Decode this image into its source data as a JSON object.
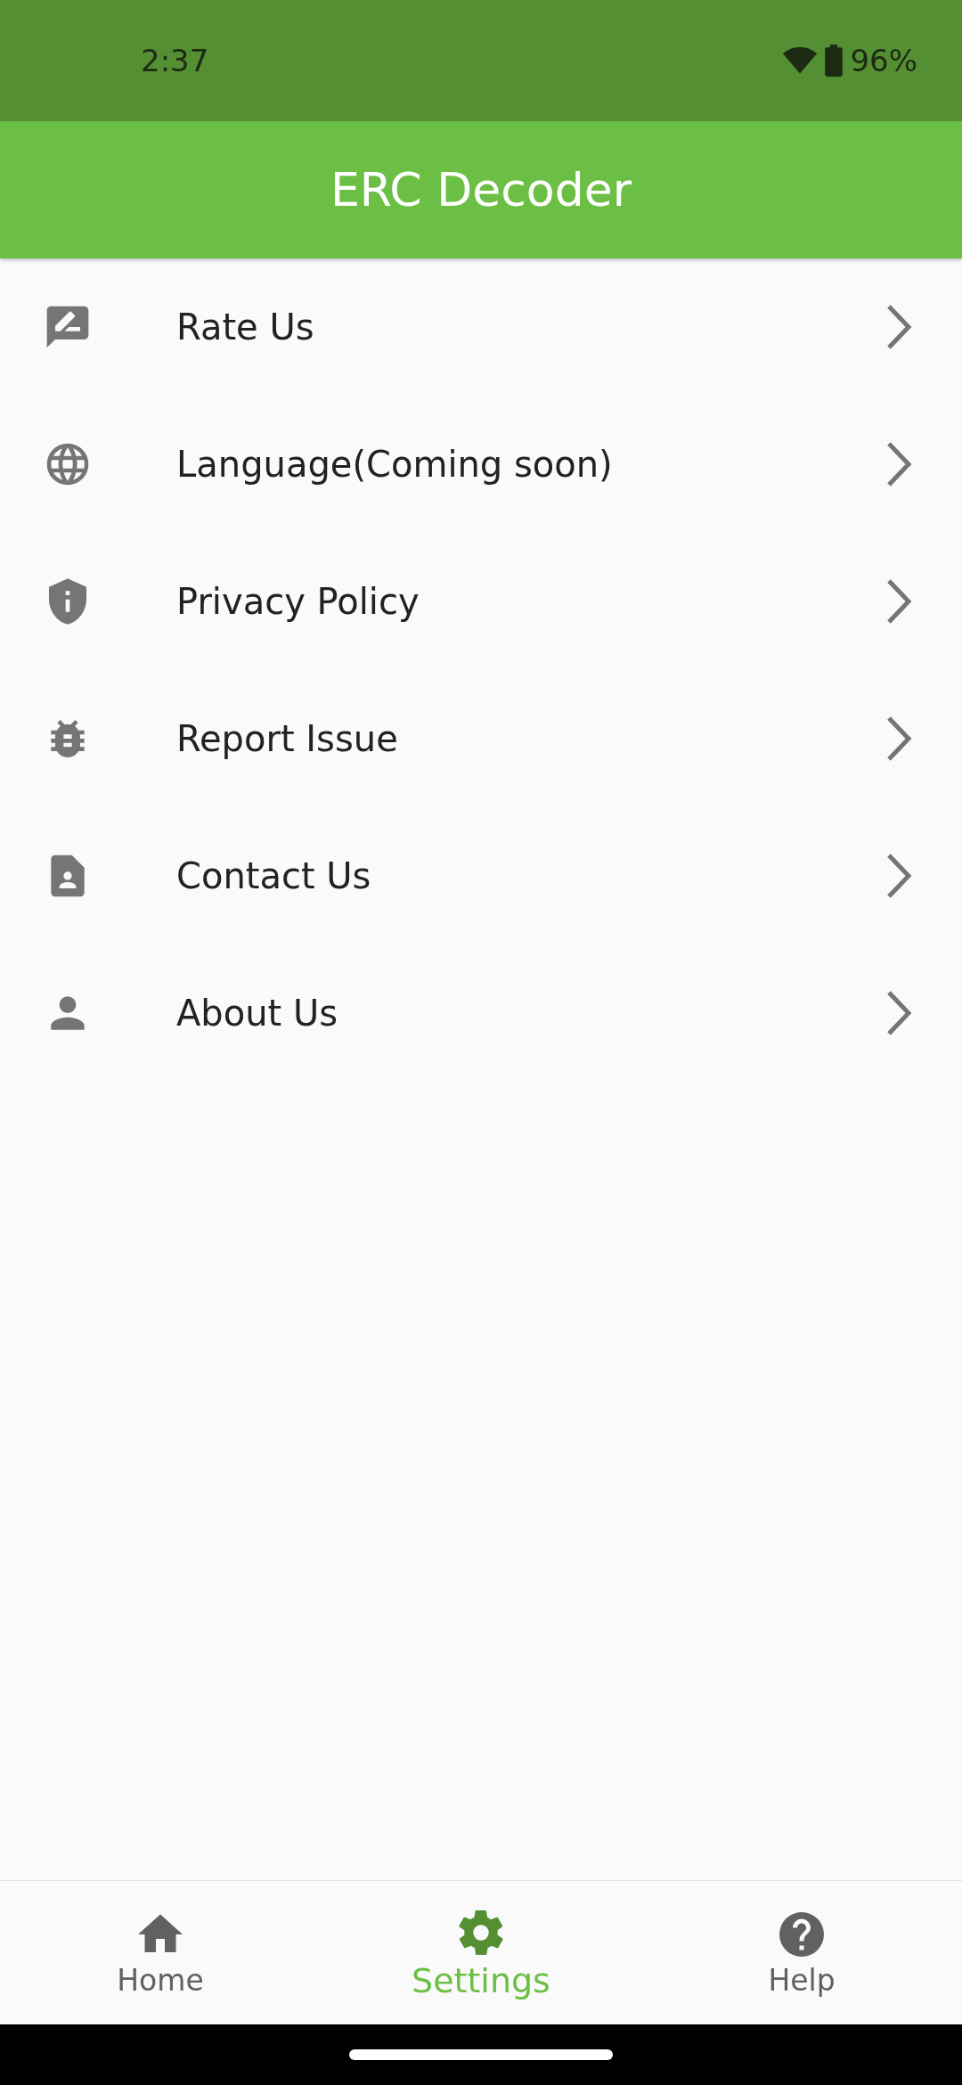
{
  "status_bar": {
    "time": "2:37",
    "battery": "96%"
  },
  "app_bar": {
    "title": "ERC Decoder"
  },
  "menu": [
    {
      "kind": "rate",
      "label": "Rate Us"
    },
    {
      "kind": "language",
      "label": "Language(Coming soon)"
    },
    {
      "kind": "privacy",
      "label": "Privacy Policy"
    },
    {
      "kind": "bug",
      "label": "Report Issue"
    },
    {
      "kind": "contact",
      "label": "Contact Us"
    },
    {
      "kind": "person",
      "label": "About Us"
    }
  ],
  "bottom_nav": [
    {
      "kind": "home",
      "label": "Home",
      "selected": false
    },
    {
      "kind": "settings",
      "label": "Settings",
      "selected": true
    },
    {
      "kind": "help",
      "label": "Help",
      "selected": false
    }
  ]
}
